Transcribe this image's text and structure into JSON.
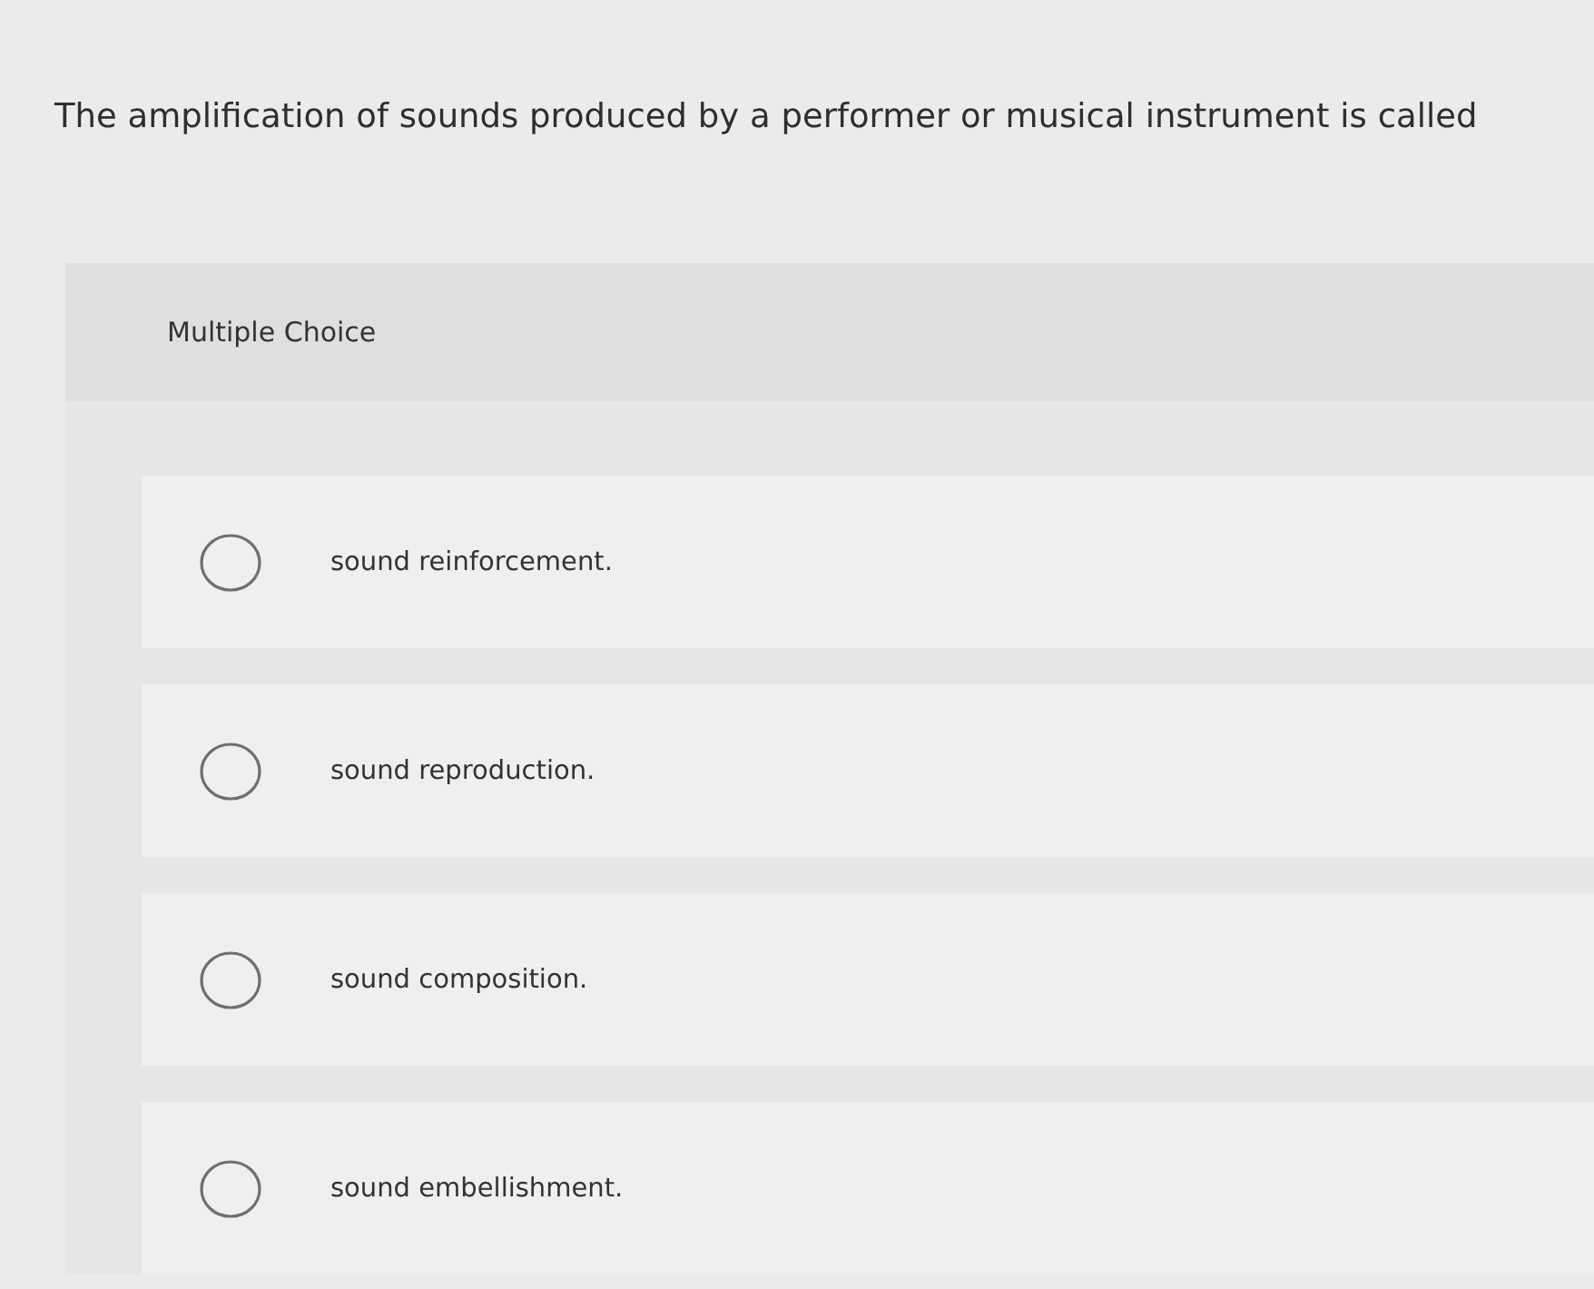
{
  "question": {
    "text": "The amplification of sounds produced by a performer or musical instrument is called"
  },
  "panel": {
    "type_label": "Multiple Choice"
  },
  "options": [
    {
      "label": "sound reinforcement.",
      "selected": false
    },
    {
      "label": "sound reproduction.",
      "selected": false
    },
    {
      "label": "sound composition.",
      "selected": false
    },
    {
      "label": "sound embellishment.",
      "selected": false
    }
  ]
}
